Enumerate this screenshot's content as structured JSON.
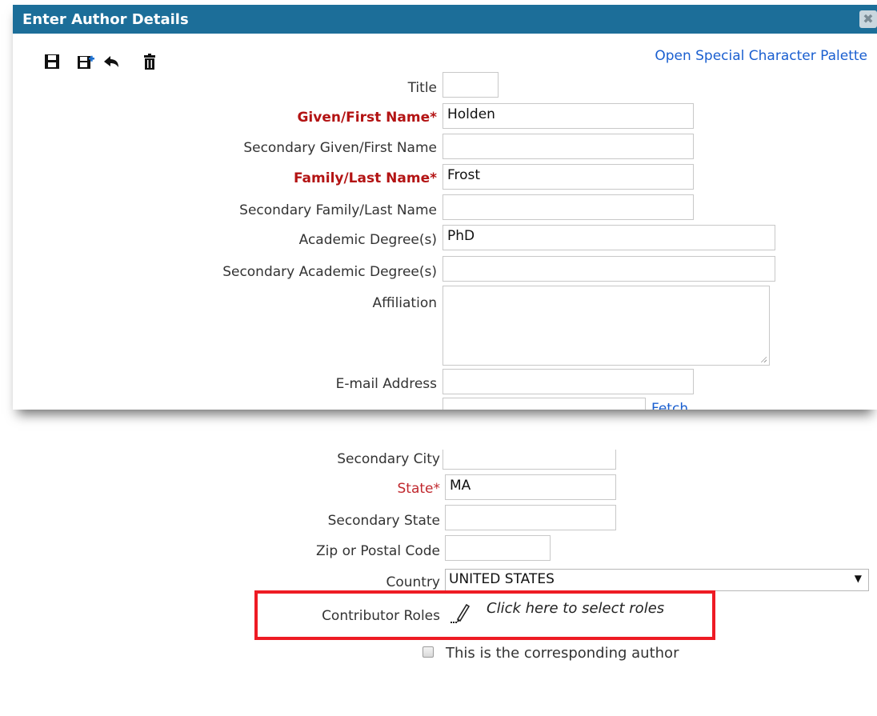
{
  "dialog": {
    "title": "Enter Author Details",
    "close_icon": "close-icon"
  },
  "toolbar": {
    "icons": [
      "save-icon",
      "save-new-icon",
      "back-icon",
      "trash-icon"
    ]
  },
  "palette_link": "Open Special Character Palette",
  "fields": {
    "title": {
      "label": "Title",
      "value": ""
    },
    "given_name": {
      "label": "Given/First Name*",
      "value": "Holden"
    },
    "secondary_given_name": {
      "label": "Secondary Given/First Name",
      "value": ""
    },
    "family_name": {
      "label": "Family/Last Name*",
      "value": "Frost"
    },
    "secondary_family_name": {
      "label": "Secondary Family/Last Name",
      "value": ""
    },
    "academic_degrees": {
      "label": "Academic Degree(s)",
      "value": "PhD"
    },
    "secondary_academic_degrees": {
      "label": "Secondary Academic Degree(s)",
      "value": ""
    },
    "affiliation": {
      "label": "Affiliation",
      "value": ""
    },
    "email": {
      "label": "E-mail Address",
      "value": ""
    },
    "partial_link": "Fetch",
    "secondary_city": {
      "label": "Secondary City",
      "value": ""
    },
    "state": {
      "label": "State*",
      "value": "MA"
    },
    "secondary_state": {
      "label": "Secondary State",
      "value": ""
    },
    "zip": {
      "label": "Zip or Postal Code",
      "value": ""
    },
    "country": {
      "label": "Country",
      "value": "UNITED STATES"
    },
    "contributor_roles": {
      "label": "Contributor Roles",
      "link": "Click here to select roles"
    },
    "corresponding": {
      "label": "This is the corresponding author",
      "checked": false
    }
  },
  "colors": {
    "titlebar": "#1c6e99",
    "required": "#b31313",
    "highlight": "#ee1b24",
    "link": "#1a5fd0"
  }
}
